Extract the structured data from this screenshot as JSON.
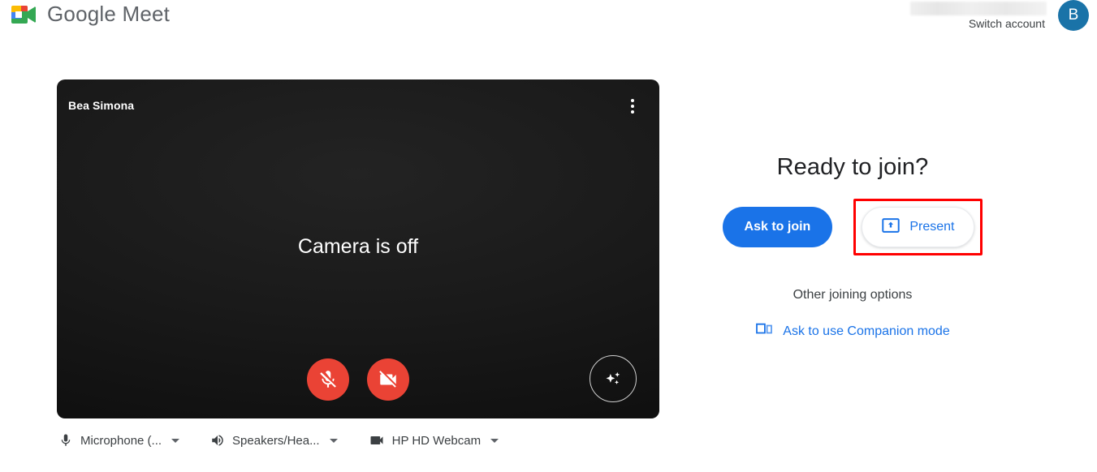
{
  "app": {
    "brand_name": "Google Meet",
    "logo_icon": "google-meet-logo"
  },
  "account": {
    "email_redacted": "",
    "switch_account_label": "Switch account",
    "avatar_initial": "B",
    "avatar_color": "#1a73a8"
  },
  "preview": {
    "participant_name": "Bea Simona",
    "camera_status_text": "Camera is off",
    "menu_icon": "more-options-vertical-icon",
    "mic_button": {
      "icon": "microphone-muted-icon",
      "state": "muted",
      "color": "#ea4335"
    },
    "camera_button": {
      "icon": "camera-off-icon",
      "state": "off",
      "color": "#ea4335"
    },
    "effects_button": {
      "icon": "sparkles-effects-icon"
    }
  },
  "devices": [
    {
      "icon": "microphone-icon",
      "label": "Microphone (...",
      "caret": "chevron-down-icon"
    },
    {
      "icon": "speaker-icon",
      "label": "Speakers/Hea...",
      "caret": "chevron-down-icon"
    },
    {
      "icon": "camera-icon",
      "label": "HP HD Webcam",
      "caret": "chevron-down-icon"
    }
  ],
  "join": {
    "title": "Ready to join?",
    "ask_to_join_label": "Ask to join",
    "present_label": "Present",
    "present_icon": "present-screen-icon",
    "present_highlight_color": "#ff0000",
    "other_options_label": "Other joining options",
    "companion_label": "Ask to use Companion mode",
    "companion_icon": "companion-mode-icon",
    "accent_color": "#1a73e8"
  }
}
